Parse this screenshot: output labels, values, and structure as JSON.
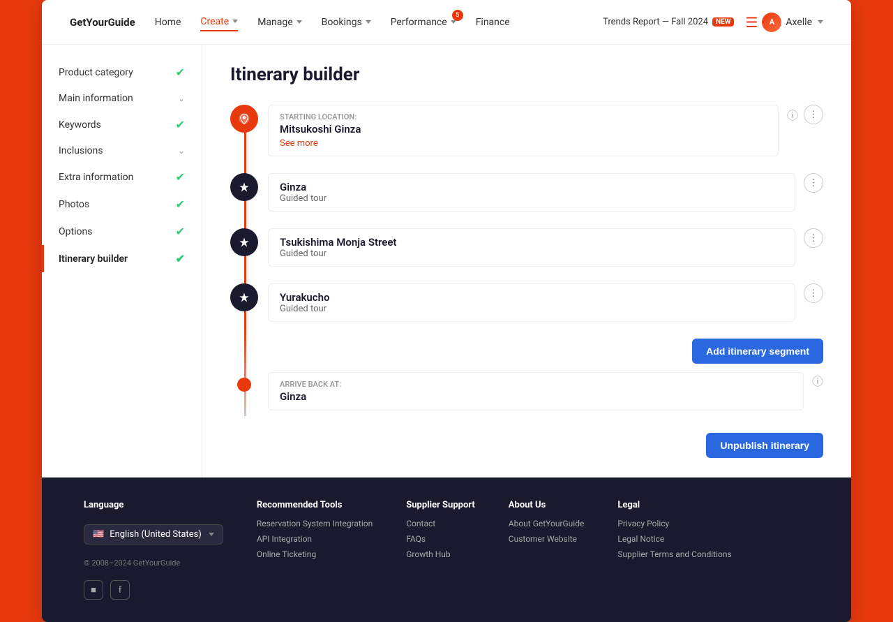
{
  "nav": {
    "items": [
      {
        "label": "Home",
        "active": false,
        "badge": null
      },
      {
        "label": "Create",
        "active": true,
        "badge": null,
        "hasDropdown": true
      },
      {
        "label": "Manage",
        "active": false,
        "badge": null,
        "hasDropdown": true
      },
      {
        "label": "Bookings",
        "active": false,
        "badge": null,
        "hasDropdown": true
      },
      {
        "label": "Performance",
        "active": false,
        "badge": "5",
        "hasDropdown": true
      },
      {
        "label": "Finance",
        "active": false,
        "badge": null,
        "hasDropdown": false
      }
    ],
    "trendsReport": "Trends Report — Fall 2024",
    "newBadge": "NEW",
    "userName": "Axelle"
  },
  "sidebar": {
    "items": [
      {
        "label": "Product category",
        "hasCheck": true,
        "hasChevron": false,
        "active": false
      },
      {
        "label": "Main information",
        "hasCheck": false,
        "hasChevron": true,
        "active": false
      },
      {
        "label": "Keywords",
        "hasCheck": true,
        "hasChevron": false,
        "active": false
      },
      {
        "label": "Inclusions",
        "hasCheck": false,
        "hasChevron": true,
        "active": false
      },
      {
        "label": "Extra information",
        "hasCheck": true,
        "hasChevron": false,
        "active": false
      },
      {
        "label": "Photos",
        "hasCheck": true,
        "hasChevron": false,
        "active": false
      },
      {
        "label": "Options",
        "hasCheck": true,
        "hasChevron": false,
        "active": false
      },
      {
        "label": "Itinerary builder",
        "hasCheck": true,
        "hasChevron": false,
        "active": true
      }
    ]
  },
  "page": {
    "title": "Itinerary builder",
    "startingLocation": {
      "label": "Starting location:",
      "name": "Mitsukoshi Ginza",
      "seeMore": "See more"
    },
    "segments": [
      {
        "name": "Ginza",
        "type": "Guided tour"
      },
      {
        "name": "Tsukishima Monja Street",
        "type": "Guided tour"
      },
      {
        "name": "Yurakucho",
        "type": "Guided tour"
      }
    ],
    "arriveBack": {
      "label": "Arrive back at:",
      "name": "Ginza"
    },
    "addSegmentBtn": "Add itinerary segment",
    "unpublishBtn": "Unpublish itinerary"
  },
  "footer": {
    "language": {
      "label": "Language",
      "selected": "English (United States)"
    },
    "copyright": "© 2008–2024 GetYourGuide",
    "recommendedTools": {
      "title": "Recommended Tools",
      "items": [
        "Reservation System Integration",
        "API Integration",
        "Online Ticketing"
      ]
    },
    "supplierSupport": {
      "title": "Supplier Support",
      "items": [
        "Contact",
        "FAQs",
        "Growth Hub"
      ]
    },
    "aboutUs": {
      "title": "About Us",
      "items": [
        "About GetYourGuide",
        "Customer Website"
      ]
    },
    "legal": {
      "title": "Legal",
      "items": [
        "Privacy Policy",
        "Legal Notice",
        "Supplier Terms and Conditions"
      ]
    }
  }
}
